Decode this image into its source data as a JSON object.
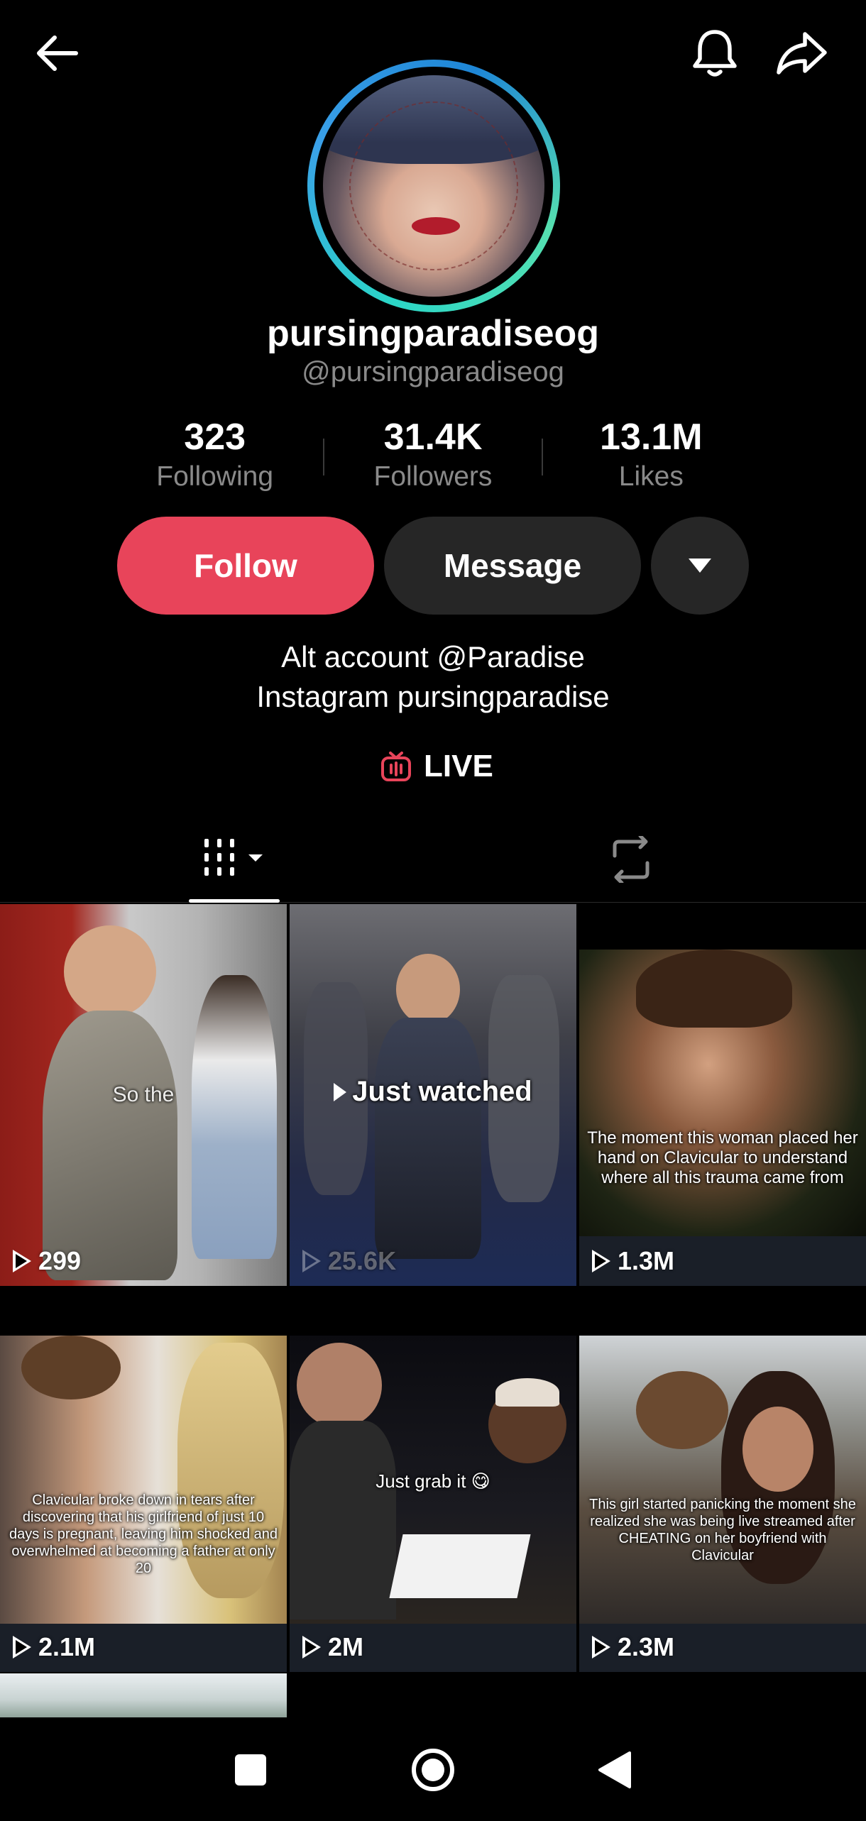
{
  "profile": {
    "display_name": "pursingparadiseog",
    "handle": "@pursingparadiseog",
    "bio_lines": [
      "Alt account @Paradise",
      "Instagram pursingparadise"
    ],
    "live_label": "LIVE"
  },
  "stats": [
    {
      "value": "323",
      "label": "Following"
    },
    {
      "value": "31.4K",
      "label": "Followers"
    },
    {
      "value": "13.1M",
      "label": "Likes"
    }
  ],
  "actions": {
    "follow_label": "Follow",
    "message_label": "Message",
    "more_icon": "caret-down-icon"
  },
  "tabs": {
    "videos_icon": "grid-icon",
    "reposts_icon": "repost-icon"
  },
  "videos": [
    {
      "caption": "So the",
      "views": "299",
      "dim": false
    },
    {
      "caption": "Just watched",
      "views": "25.6K",
      "dim": true
    },
    {
      "caption": "The moment this woman placed her hand on Clavicular to understand where all this trauma came from",
      "views": "1.3M",
      "dim": false
    },
    {
      "caption": "Clavicular broke down in tears after discovering that his girlfriend of just 10 days is pregnant, leaving him shocked and overwhelmed at becoming a father at only 20",
      "views": "2.1M",
      "dim": false
    },
    {
      "caption": "Just grab it 😋",
      "views": "2M",
      "dim": false
    },
    {
      "caption": "This girl started panicking the moment she realized she was being live streamed after CHEATING on her boyfriend with Clavicular",
      "views": "2.3M",
      "dim": false
    }
  ],
  "colors": {
    "accent": "#e8445a",
    "button_dark": "#262626",
    "avatar_ring": "#2bd6c7"
  }
}
